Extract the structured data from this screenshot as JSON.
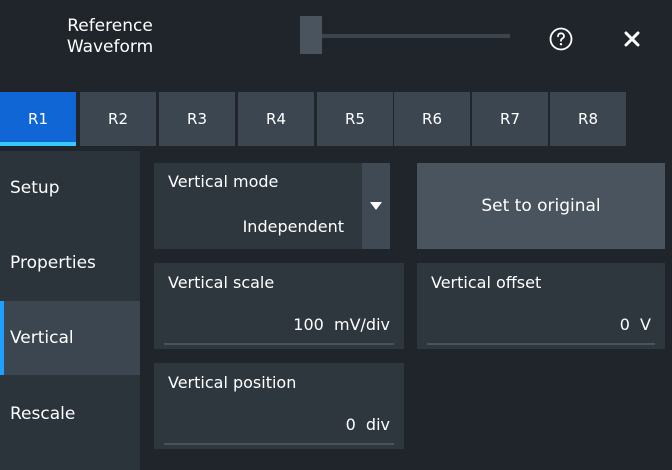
{
  "window": {
    "title_line1": "Reference",
    "title_line2": "Waveform",
    "help_icon": "question-circle-icon",
    "close_icon": "close-x-icon"
  },
  "tabs": [
    {
      "label": "R1",
      "active": true
    },
    {
      "label": "R2",
      "active": false
    },
    {
      "label": "R3",
      "active": false
    },
    {
      "label": "R4",
      "active": false
    },
    {
      "label": "R5",
      "active": false
    },
    {
      "label": "R6",
      "active": false
    },
    {
      "label": "R7",
      "active": false
    },
    {
      "label": "R8",
      "active": false
    }
  ],
  "sidebar": {
    "items": [
      {
        "label": "Setup",
        "active": false
      },
      {
        "label": "Properties",
        "active": false
      },
      {
        "label": "Vertical",
        "active": true
      },
      {
        "label": "Rescale",
        "active": false
      }
    ]
  },
  "vertical_mode": {
    "label": "Vertical mode",
    "value": "Independent"
  },
  "set_to_original": {
    "label": "Set to original"
  },
  "vertical_scale": {
    "label": "Vertical scale",
    "value": "100  mV/div"
  },
  "vertical_offset": {
    "label": "Vertical offset",
    "value": "0  V"
  },
  "vertical_position": {
    "label": "Vertical position",
    "value": "0  div"
  },
  "colors": {
    "accent": "#1166d6",
    "accent_highlight": "#37c8ff",
    "background": "#1f252b",
    "panel": "#2e363e"
  }
}
